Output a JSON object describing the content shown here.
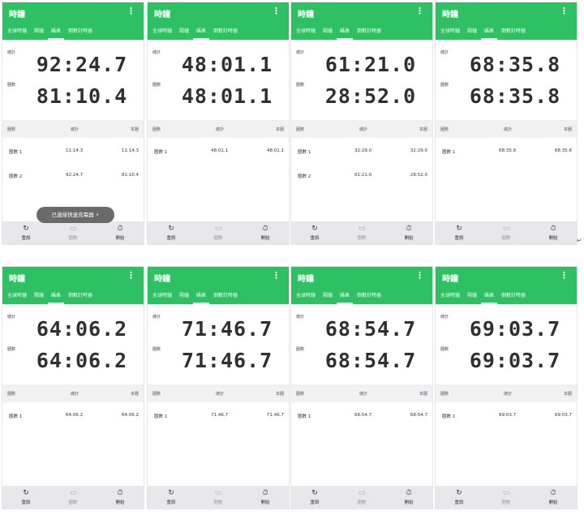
{
  "app": {
    "title": "時鐘",
    "menu_icon": "more-vert-icon",
    "tabs": [
      "全球時鐘",
      "鬧鐘",
      "碼表",
      "倒數計時器"
    ],
    "active_tab": "碼表",
    "accent_color": "#2fc064"
  },
  "labels": {
    "total": "總計",
    "lap": "圈數"
  },
  "table_headers": [
    "圈數",
    "總計",
    "本圈"
  ],
  "buttons": {
    "reset": "重設",
    "lap": "圈數",
    "start": "開始",
    "reset_icon": "refresh-icon",
    "lap_icon": "flag-icon",
    "start_icon": "timer-icon"
  },
  "toast": "已連接快速充電器 ⚡",
  "panels": [
    {
      "total_time": "92:24.7",
      "lap_time": "81:10.4",
      "rows": [
        {
          "lap": "圈數 1",
          "total": "11:14.3",
          "split": "11:14.3"
        },
        {
          "lap": "圈數 2",
          "total": "92:24.7",
          "split": "81:10.4"
        }
      ]
    },
    {
      "total_time": "48:01.1",
      "lap_time": "48:01.1",
      "rows": [
        {
          "lap": "圈數 1",
          "total": "48:01.1",
          "split": "48:01.1"
        }
      ]
    },
    {
      "total_time": "61:21.0",
      "lap_time": "28:52.0",
      "rows": [
        {
          "lap": "圈數 1",
          "total": "32:29.0",
          "split": "32:29.0"
        },
        {
          "lap": "圈數 2",
          "total": "61:21.0",
          "split": "28:52.0"
        }
      ]
    },
    {
      "total_time": "68:35.8",
      "lap_time": "68:35.8",
      "rows": [
        {
          "lap": "圈數 1",
          "total": "68:35.8",
          "split": "68:35.8"
        }
      ]
    },
    {
      "total_time": "64:06.2",
      "lap_time": "64:06.2",
      "rows": [
        {
          "lap": "圈數 1",
          "total": "64:06.2",
          "split": "64:06.2"
        }
      ]
    },
    {
      "total_time": "71:46.7",
      "lap_time": "71:46.7",
      "rows": [
        {
          "lap": "圈數 1",
          "total": "71:46.7",
          "split": "71:46.7"
        }
      ]
    },
    {
      "total_time": "68:54.7",
      "lap_time": "68:54.7",
      "rows": [
        {
          "lap": "圈數 1",
          "total": "68:54.7",
          "split": "68:54.7"
        }
      ]
    },
    {
      "total_time": "69:03.7",
      "lap_time": "69:03.7",
      "rows": [
        {
          "lap": "圈數 1",
          "total": "69:03.7",
          "split": "69:03.7"
        }
      ]
    }
  ]
}
